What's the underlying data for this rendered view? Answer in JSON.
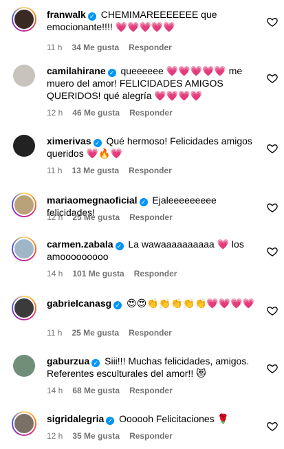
{
  "comments": [
    {
      "username": "franwalk",
      "verified": true,
      "text": "CHEMIMAREEEEEEE que emocionante!!!! 💗💗💗💗💗",
      "time": "11 h",
      "likes": "34 Me gusta",
      "reply": "Responder",
      "avatar_color": "#3a2a24",
      "ring": true
    },
    {
      "username": "camilahirane",
      "verified": true,
      "text": "queeeeee 💗💗💗💗💗 me muero del amor! FELICIDADES AMIGOS QUERIDOS! qué alegría 💗💗💗💗",
      "time": "12 h",
      "likes": "46 Me gusta",
      "reply": "Responder",
      "avatar_color": "#c9c3bd",
      "ring": false
    },
    {
      "username": "ximerivas",
      "verified": true,
      "text": "Qué hermoso! Felicidades amigos queridos 💗🔥💗",
      "time": "11 h",
      "likes": "13 Me gusta",
      "reply": "Responder",
      "avatar_color": "#222222",
      "ring": false
    },
    {
      "username": "mariaomegnaoficial",
      "verified": true,
      "text": "Ejaleeeeeeeee felicidades!",
      "time": "12 h",
      "likes": "25 Me gusta",
      "reply": "Responder",
      "avatar_color": "#b9a27a",
      "ring": true
    },
    {
      "username": "carmen.zabala",
      "verified": true,
      "text": "La wawaaaaaaaaaa 💗 los amooooooooo",
      "time": "14 h",
      "likes": "101 Me gusta",
      "reply": "Responder",
      "avatar_color": "#9fb6c8",
      "ring": true
    },
    {
      "username": "gabrielcanasg",
      "verified": true,
      "text": "😍😍👏👏👏👏👏💗💗💗💗",
      "time": "11 h",
      "likes": "25 Me gusta",
      "reply": "Responder",
      "avatar_color": "#3b3b3b",
      "ring": true
    },
    {
      "username": "gaburzua",
      "verified": true,
      "text": "Siii!!! Muchas felicidades, amigos. Referentes esculturales del amor!! 😻",
      "time": "14 h",
      "likes": "68 Me gusta",
      "reply": "Responder",
      "avatar_color": "#6f8f78",
      "ring": false
    },
    {
      "username": "sigridalegria",
      "verified": true,
      "text": "Oooooh Felicitaciones 🌹",
      "time": "12 h",
      "likes": "35 Me gusta",
      "reply": "Responder",
      "avatar_color": "#7b7066",
      "ring": true
    }
  ]
}
